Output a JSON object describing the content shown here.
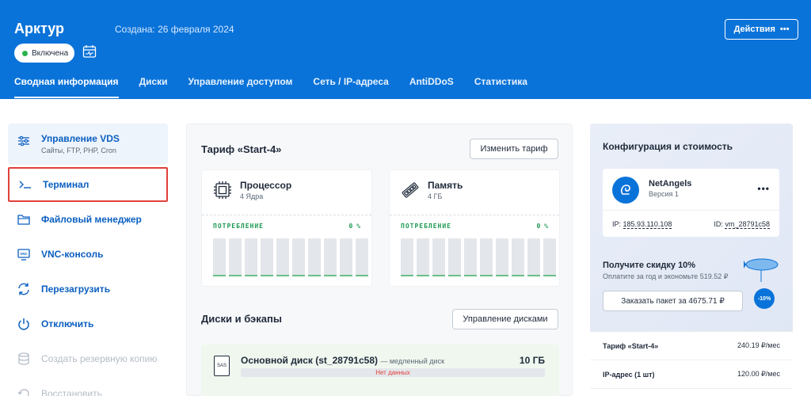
{
  "header": {
    "server_name": "Арктур",
    "created": "Создана: 26 февраля 2024",
    "status": "Включена",
    "actions_label": "Действия",
    "actions_dots": "•••",
    "tabs": [
      {
        "label": "Сводная информация"
      },
      {
        "label": "Диски"
      },
      {
        "label": "Управление доступом"
      },
      {
        "label": "Сеть / IP-адреса"
      },
      {
        "label": "AntiDDoS"
      },
      {
        "label": "Статистика"
      }
    ]
  },
  "sidebar": {
    "items": [
      {
        "label": "Управление VDS",
        "sub": "Сайты, FTP, PHP, Cron",
        "icon": "sliders-icon"
      },
      {
        "label": "Терминал",
        "icon": "terminal-icon"
      },
      {
        "label": "Файловый менеджер",
        "icon": "folder-icon"
      },
      {
        "label": "VNC-консоль",
        "icon": "vnc-icon"
      },
      {
        "label": "Перезагрузить",
        "icon": "restart-icon"
      },
      {
        "label": "Отключить",
        "icon": "power-icon"
      },
      {
        "label": "Создать резервную копию",
        "icon": "database-icon"
      },
      {
        "label": "Восстановить",
        "icon": "restore-icon"
      }
    ]
  },
  "main": {
    "tariff_title": "Тариф «Start-4»",
    "change_tariff": "Изменить тариф",
    "cpu": {
      "name": "Процессор",
      "sub": "4 Ядра",
      "usage_label": "ПОТРЕБЛЕНИЕ",
      "usage_value": "0 %"
    },
    "ram": {
      "name": "Память",
      "sub": "4 ГБ",
      "usage_label": "ПОТРЕБЛЕНИЕ",
      "usage_value": "0 %"
    },
    "disks_title": "Диски и бэкапы",
    "manage_disks": "Управление дисками",
    "disk": {
      "icon_text": "SAS",
      "name": "Основной диск (st_28791c58)",
      "type": "— медленный диск",
      "size": "10 ГБ",
      "no_data": "Нет данных"
    }
  },
  "config": {
    "title": "Конфигурация и стоимость",
    "brand": "NetAngels",
    "version": "Версия 1",
    "menu": "•••",
    "ip_label": "IP:",
    "ip_value": "185.93.110.108",
    "id_label": "ID:",
    "id_value": "vm_28791c58",
    "promo_title": "Получите скидку 10%",
    "promo_sub": "Оплатите за год и экономьте 519.52 ₽",
    "promo_btn": "Заказать пакет за 4675.71 ₽",
    "badge": "-10%",
    "prices": [
      {
        "label": "Тариф «Start-4»",
        "value": "240.19 ₽/мес"
      },
      {
        "label": "IP-адрес (1 шт)",
        "value": "120.00 ₽/мес"
      }
    ]
  },
  "colors": {
    "brand_blue": "#0a73d9",
    "status_green": "#2bb24c",
    "highlight_red": "#e0413a"
  }
}
